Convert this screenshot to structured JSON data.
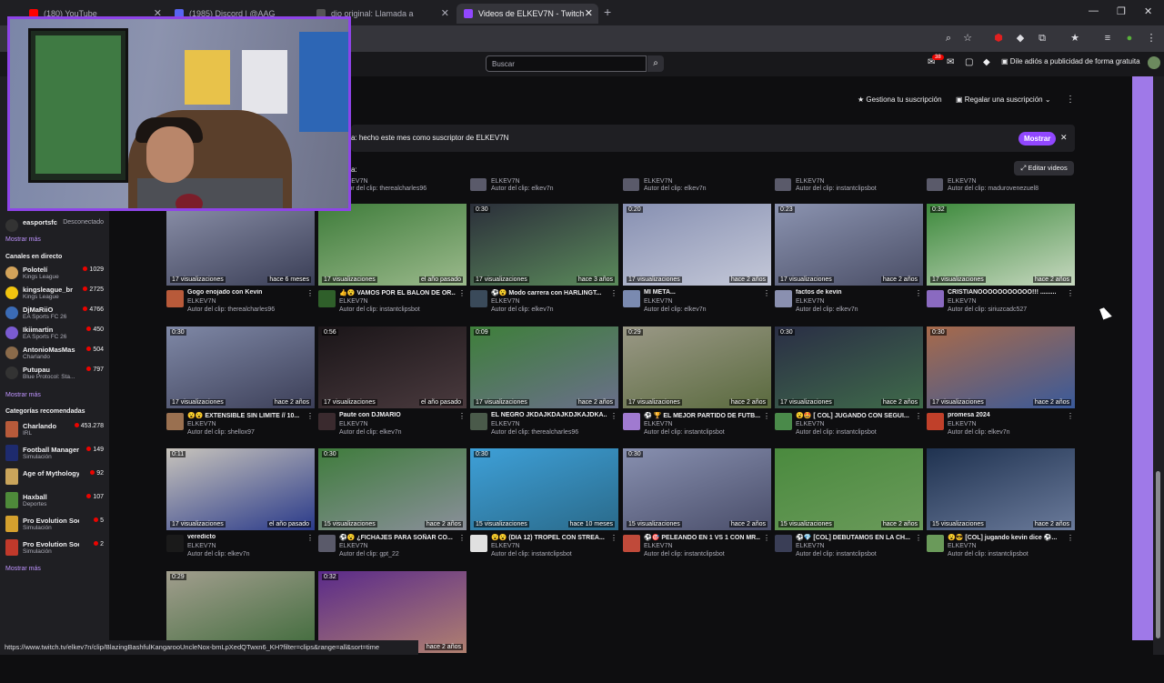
{
  "browser": {
    "tabs": [
      {
        "title": "(180) YouTube",
        "color": "#ff0000"
      },
      {
        "title": "(1985) Discord | @AAG",
        "color": "#5865f2"
      },
      {
        "title": "dio original: Llamada a",
        "color": "#555555"
      },
      {
        "title": "Videos de ELKEV7N - Twitch",
        "color": "#9147ff"
      }
    ],
    "new_tab": "+",
    "minimize": "—",
    "restore": "❐",
    "close": "✕",
    "status_url": "https://www.twitch.tv/elkev7n/clip/BlazingBashfulKangarooUncleNox-bmLpXedQTwxn6_KH?filter=clips&range=all&sort=time"
  },
  "twitch": {
    "search_placeholder": "Buscar",
    "notif_count": "38",
    "ad_free": "Dile adiós a publicidad de forma gratuita"
  },
  "sidebar": {
    "top_item": {
      "name": "easportsfc",
      "status": "Desconectado"
    },
    "more1": "Mostrar más",
    "live_title": "Canales en directo",
    "live": [
      {
        "name": "Polotelí",
        "sub": "Kings League",
        "count": "1029",
        "color": "#d2a35a"
      },
      {
        "name": "kingsleague_br",
        "sub": "Kings League",
        "count": "2725",
        "color": "#f1c40f"
      },
      {
        "name": "DjMaRiiO",
        "sub": "EA Sports FC 26",
        "count": "4766",
        "color": "#3b6bb5"
      },
      {
        "name": "Ikiimartin",
        "sub": "EA Sports FC 26",
        "count": "450",
        "color": "#7a5bd1"
      },
      {
        "name": "AntonioMasMas",
        "sub": "Charlando",
        "count": "504",
        "color": "#8a6a4a"
      },
      {
        "name": "Putupau",
        "sub": "Blue Protocol: Sta...",
        "count": "797",
        "color": "#333333"
      }
    ],
    "more2": "Mostrar más",
    "rec_title": "Categorías recomendadas",
    "categories": [
      {
        "name": "Charlando",
        "sub": "IRL",
        "count": "453.278",
        "color": "#b75a3a"
      },
      {
        "name": "Football Manager ...",
        "sub": "Simulación",
        "count": "149",
        "color": "#1e2b6e"
      },
      {
        "name": "Age of Mythology",
        "sub": "",
        "count": "92",
        "color": "#c9a45b"
      },
      {
        "name": "Haxball",
        "sub": "Deportes",
        "count": "107",
        "color": "#4e8a3a"
      },
      {
        "name": "Pro Evolution Soc...",
        "sub": "Simulación",
        "count": "5",
        "color": "#d4a02e"
      },
      {
        "name": "Pro Evolution Soc...",
        "sub": "Simulación",
        "count": "2",
        "color": "#c0392b"
      }
    ],
    "more3": "Mostrar más"
  },
  "channel": {
    "manage_sub": "Gestiona tu suscripción",
    "gift_sub": "Regalar una suscripción",
    "more_menu": "⋮",
    "notice": "a: hecho este mes como suscriptor de ELKEV7N",
    "show": "Mostrar",
    "close": "✕",
    "cut_label": "a:",
    "edit_videos": "Editar videos"
  },
  "top_row": [
    {
      "chan": "ELKEV7N",
      "author": "Autor del clip: therealcharles96"
    },
    {
      "chan": "ELKEV7N",
      "author": "Autor del clip: elkev7n"
    },
    {
      "chan": "ELKEV7N",
      "author": "Autor del clip: elkev7n"
    },
    {
      "chan": "ELKEV7N",
      "author": "Autor del clip: instantclipsbot"
    },
    {
      "chan": "ELKEV7N",
      "author": "Autor del clip: madurovenezuel8"
    }
  ],
  "clips": [
    {
      "duration": "",
      "views": "17 visualizaciones",
      "ago": "hace 6 meses",
      "title": "Gogo enojado con Kevin",
      "channel": "ELKEV7N",
      "author": "Autor del clip: therealcharles96",
      "c1": "#8a8fa8",
      "c2": "#3a3e56",
      "av": "#b85a3a"
    },
    {
      "duration": "",
      "views": "17 visualizaciones",
      "ago": "el año pasado",
      "title": "👍😮 VAMOS POR EL BALON DE OR...",
      "channel": "ELKEV7N",
      "author": "Autor del clip: instantclipsbot",
      "c1": "#3f7d3b",
      "c2": "#9bb98c",
      "av": "#2f5f2a"
    },
    {
      "duration": "0:30",
      "views": "17 visualizaciones",
      "ago": "hace 3 años",
      "title": "⚽😮 Modo carrera con HARLINGT...",
      "channel": "ELKEV7N",
      "author": "Autor del clip: elkev7n",
      "c1": "#2b2f3a",
      "c2": "#5b8a5b",
      "av": "#3a4a5a"
    },
    {
      "duration": "0:20",
      "views": "17 visualizaciones",
      "ago": "hace 2 años",
      "title": "MI META...",
      "channel": "ELKEV7N",
      "author": "Autor del clip: elkev7n",
      "c1": "#8790b2",
      "c2": "#c4c8d8",
      "av": "#7a8ab0"
    },
    {
      "duration": "0:23",
      "views": "17 visualizaciones",
      "ago": "hace 2 años",
      "title": "factos de kevin",
      "channel": "ELKEV7N",
      "author": "Autor del clip: elkev7n",
      "c1": "#8b93b0",
      "c2": "#4a4e66",
      "av": "#8a90b0"
    },
    {
      "duration": "0:32",
      "views": "17 visualizaciones",
      "ago": "hace 2 años",
      "title": "CRISTIANOOOOOOOOOOO!!! .........",
      "channel": "ELKEV7N",
      "author": "Autor del clip: siriuzcadc527",
      "c1": "#3d8a3c",
      "c2": "#c7d8c0",
      "av": "#8a6ac0"
    },
    {
      "duration": "0:30",
      "views": "17 visualizaciones",
      "ago": "hace 2 años",
      "title": "😮😮 EXTENSIBLE SIN LIMITE // 10...",
      "channel": "ELKEV7N",
      "author": "Autor del clip: shellox97",
      "c1": "#7f88a6",
      "c2": "#3c3f58",
      "av": "#9a7050"
    },
    {
      "duration": "0:56",
      "views": "17 visualizaciones",
      "ago": "el año pasado",
      "title": "Paute con DJMARIO",
      "channel": "ELKEV7N",
      "author": "Autor del clip: elkev7n",
      "c1": "#1a1518",
      "c2": "#4a3a3e",
      "av": "#3a2a2e"
    },
    {
      "duration": "0:09",
      "views": "17 visualizaciones",
      "ago": "hace 2 años",
      "title": "EL NEGRO JKDAJKDAJKDJKAJDKA...",
      "channel": "ELKEV7N",
      "author": "Autor del clip: therealcharles96",
      "c1": "#3e7f3a",
      "c2": "#6a6f8a",
      "av": "#4a5a4a"
    },
    {
      "duration": "0:29",
      "views": "17 visualizaciones",
      "ago": "hace 2 años",
      "title": "⚽ 🏆 EL MEJOR PARTIDO DE FUTB...",
      "channel": "ELKEV7N",
      "author": "Autor del clip: instantclipsbot",
      "c1": "#9a9886",
      "c2": "#5a6a3e",
      "av": "#a07ad0"
    },
    {
      "duration": "0:30",
      "views": "17 visualizaciones",
      "ago": "hace 2 años",
      "title": "😮🤩 [ COL] JUGANDO CON SEGUI...",
      "channel": "ELKEV7N",
      "author": "Autor del clip: instantclipsbot",
      "c1": "#2a2e45",
      "c2": "#3f6a4a",
      "av": "#4a8a4a"
    },
    {
      "duration": "0:30",
      "views": "17 visualizaciones",
      "ago": "hace 2 años",
      "title": "promesa 2024",
      "channel": "ELKEV7N",
      "author": "Autor del clip: elkev7n",
      "c1": "#a86a4a",
      "c2": "#3a5a9a",
      "av": "#c0402a"
    },
    {
      "duration": "0:11",
      "views": "17 visualizaciones",
      "ago": "el año pasado",
      "title": "veredicto",
      "channel": "ELKEV7N",
      "author": "Autor del clip: elkev7n",
      "c1": "#c8c4bc",
      "c2": "#2a3a8a",
      "av": "#1a1a1a"
    },
    {
      "duration": "0:30",
      "views": "15 visualizaciones",
      "ago": "hace 2 años",
      "title": "⚽😮 ¿FICHAJES PARA SOÑAR CO...",
      "channel": "ELKEV7N",
      "author": "Autor del clip: gpt_22",
      "c1": "#3f7c3c",
      "c2": "#8a8f9a",
      "av": "#5a5a6a"
    },
    {
      "duration": "0:30",
      "views": "15 visualizaciones",
      "ago": "hace 10 meses",
      "title": "😮😮 (DIA 12) TROPEL CON STREA...",
      "channel": "ELKEV7N",
      "author": "Autor del clip: instantclipsbot",
      "c1": "#3ea0d8",
      "c2": "#2a6a8a",
      "av": "#e0e0e0"
    },
    {
      "duration": "0:30",
      "views": "15 visualizaciones",
      "ago": "hace 2 años",
      "title": "⚽🎯 PELEANDO EN 1 VS 1 CON MR...",
      "channel": "ELKEV7N",
      "author": "Autor del clip: instantclipsbot",
      "c1": "#8890b0",
      "c2": "#4a4e6a",
      "av": "#c04a3a"
    },
    {
      "duration": "",
      "views": "15 visualizaciones",
      "ago": "hace 2 años",
      "title": "⚽💎 [COL] DEBUTAMOS EN LA CH...",
      "channel": "ELKEV7N",
      "author": "Autor del clip: instantclipsbot",
      "c1": "#4a8a3e",
      "c2": "#6a9a5a",
      "av": "#3a3e56"
    },
    {
      "duration": "",
      "views": "15 visualizaciones",
      "ago": "hace 2 años",
      "title": "😮😎 [COL] jugando kevin dice ⚽...",
      "channel": "ELKEV7N",
      "author": "Autor del clip: instantclipsbot",
      "c1": "#1f3250",
      "c2": "#6a7a9a",
      "av": "#6a9a5a"
    },
    {
      "duration": "0:29",
      "views": "",
      "ago": "",
      "title": "",
      "channel": "",
      "author": "",
      "c1": "#a29e8e",
      "c2": "#3e6a3a",
      "av": "#000000"
    },
    {
      "duration": "0:32",
      "views": "",
      "ago": "hace 2 años",
      "title": "",
      "channel": "",
      "author": "",
      "c1": "#5a2a8a",
      "c2": "#b08070",
      "av": "#000000"
    }
  ]
}
